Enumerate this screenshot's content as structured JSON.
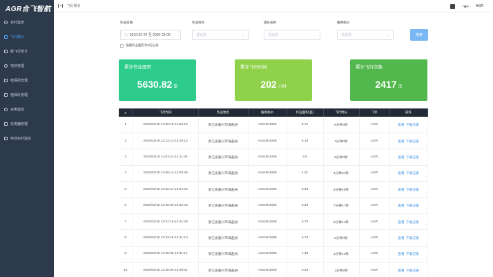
{
  "app": {
    "logo": "AGR合飞智航"
  },
  "sidebar": {
    "items": [
      {
        "label": "实时监管",
        "icon": "monitor-icon",
        "active": false
      },
      {
        "label": "飞行统计",
        "icon": "chart-icon",
        "active": true
      },
      {
        "label": "新飞行统计",
        "icon": "chart-icon",
        "active": false
      },
      {
        "label": "地块管理",
        "icon": "field-icon",
        "active": false
      },
      {
        "label": "植保机管理",
        "icon": "drone-icon",
        "active": false
      },
      {
        "label": "植保队管理",
        "icon": "team-icon",
        "active": false
      },
      {
        "label": "充电监控",
        "icon": "charge-icon",
        "active": false
      },
      {
        "label": "充电器管理",
        "icon": "charger-icon",
        "active": false
      },
      {
        "label": "电池实时监控",
        "icon": "battery-icon",
        "active": false
      }
    ]
  },
  "header": {
    "breadcrumb": "飞行统计",
    "user": "AGR"
  },
  "filters": {
    "date_label": "作业日期",
    "date_value": "2019-02-24 至 2020-03-02",
    "location_label": "作业地点",
    "location_placeholder": "请选择",
    "team_label": "团队名称",
    "team_placeholder": "请选择",
    "drone_label": "植保机ID",
    "drone_placeholder": "请选择",
    "search_label": "搜索",
    "hide_zero_label": "隐藏作业面积为0的记录"
  },
  "stats": [
    {
      "title": "累计作业面积",
      "value": "5630.82",
      "unit": "亩",
      "color": "#2ecc8b"
    },
    {
      "title": "累计飞行时间",
      "value": "202",
      "unit": "小时",
      "color": "#8fd14a"
    },
    {
      "title": "累计飞行次数",
      "value": "2417",
      "unit": "次",
      "color": "#52b84d"
    }
  ],
  "table": {
    "columns": [
      "#",
      "飞行时间",
      "作业地点",
      "植保机ID",
      "作业面积(亩)",
      "飞行时长",
      "飞手",
      "操作"
    ],
    "op_view": "查看",
    "op_download": "下载记录",
    "rows": [
      [
        "1",
        "2020/02/19 14:50:16-14:56:19",
        "浙江省嘉兴市海盐县",
        "A161901009",
        "6.72",
        "6分钟3秒",
        "AGR"
      ],
      [
        "2",
        "2020/02/19 14:13:13-14:20:13",
        "浙江省嘉兴市海盐县",
        "A161901009",
        "5.19",
        "7分钟0秒",
        "AGR"
      ],
      [
        "3",
        "2020/02/19 14:03:21-14:11:25",
        "浙江省嘉兴市海盐县",
        "A161901009",
        "3.9",
        "8分钟4秒",
        "AGR"
      ],
      [
        "4",
        "2020/02/19 13:56:14-14:00:48",
        "浙江省嘉兴市海盐县",
        "A161901009",
        "1.21",
        "4分钟34秒",
        "AGR"
      ],
      [
        "5",
        "2020/02/19 13:52:44-13:54:25",
        "浙江省嘉兴市海盐县",
        "A161901009",
        "6.48",
        "9分钟29秒",
        "AGR"
      ],
      [
        "6",
        "2020/02/19 13:45:00-13:52:40",
        "浙江省嘉兴市海盐县",
        "A161901009",
        "5.19",
        "7分钟47秒",
        "AGR"
      ],
      [
        "7",
        "2020/02/19 13:41:16-13:41:29",
        "浙江省嘉兴市海盐县",
        "A161901009",
        "5.73",
        "8分钟14秒",
        "AGR"
      ],
      [
        "8",
        "2020/02/19 13:33:16-13:41:10",
        "浙江省嘉兴市海盐县",
        "A161901009",
        "6.73",
        "8分钟4秒",
        "AGR"
      ],
      [
        "9",
        "2020/02/19 13:29:05-13:31:14",
        "浙江省嘉兴市海盐县",
        "A161901009",
        "1.49",
        "3分钟13秒",
        "AGR"
      ],
      [
        "10",
        "2020/02/19 13:28:00-13:29:01",
        "浙江省嘉兴市海盐县",
        "A161901009",
        "0.23",
        "1分钟2秒",
        "AGR"
      ]
    ]
  }
}
